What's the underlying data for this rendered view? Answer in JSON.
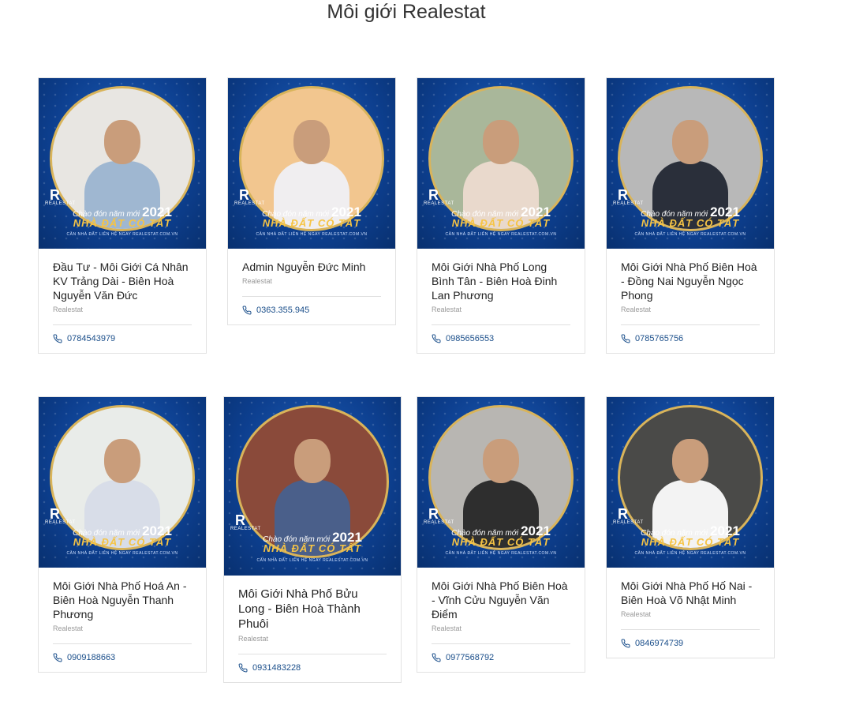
{
  "page": {
    "title": "Môi giới Realestat"
  },
  "banner": {
    "logo": "R",
    "logo_text": "REALESTAT",
    "line1": "Chào đón năm mới",
    "year": "2021",
    "line2": "NHÀ ĐẤT CÓ TẤT",
    "line3": "CĂN NHÀ ĐẤT LIÊN HỆ NGAY   REALESTAT.COM.VN"
  },
  "agents": [
    {
      "name": "Đầu Tư - Môi Giới Cá Nhân KV Trảng Dài - Biên Hoà Nguyễn Văn Đức",
      "agency": "Realestat",
      "phone": "0784543979"
    },
    {
      "name": "Admin Nguyễn Đức Minh",
      "agency": "Realestat",
      "phone": "0363.355.945"
    },
    {
      "name": "Môi Giới Nhà Phố Long Bình Tân - Biên Hoà Đinh Lan Phương",
      "agency": "Realestat",
      "phone": "0985656553"
    },
    {
      "name": "Môi Giới Nhà Phố Biên Hoà - Đồng Nai Nguyễn Ngọc Phong",
      "agency": "Realestat",
      "phone": "0785765756"
    },
    {
      "name": "Môi Giới Nhà Phố Hoá An - Biên Hoà Nguyễn Thanh Phương",
      "agency": "Realestat",
      "phone": "0909188663"
    },
    {
      "name": "Môi Giới Nhà Phố Bửu Long - Biên Hoà Thành Phuôi",
      "agency": "Realestat",
      "phone": "0931483228"
    },
    {
      "name": "Môi Giới Nhà Phố Biên Hoà - Vĩnh Cửu Nguyễn Văn Điểm",
      "agency": "Realestat",
      "phone": "0977568792"
    },
    {
      "name": "Môi Giới Nhà Phố Hố Nai - Biên Hoà Võ Nhật Minh",
      "agency": "Realestat",
      "phone": "0846974739"
    }
  ],
  "colors": {
    "accent": "#1a4e8a",
    "banner_blue": "#0d3f8f",
    "gold": "#f6c445"
  }
}
